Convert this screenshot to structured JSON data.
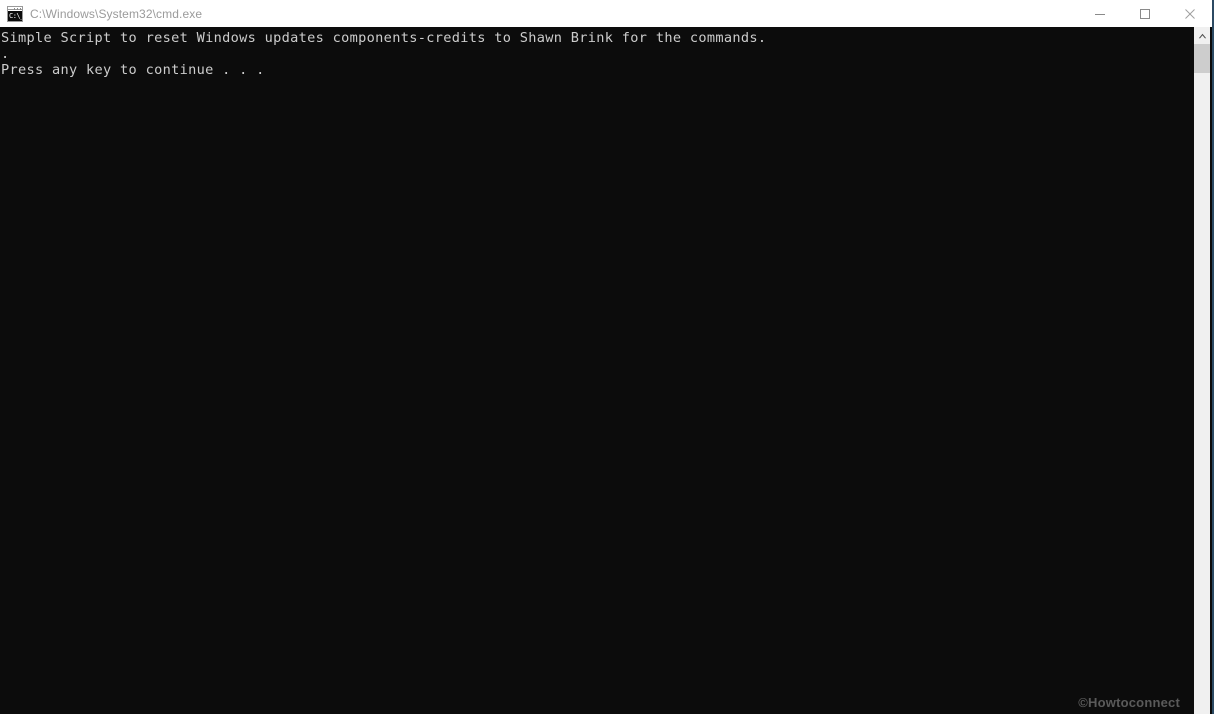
{
  "window": {
    "title": "C:\\Windows\\System32\\cmd.exe",
    "icon_name": "cmd-icon",
    "icon_glyph": "C:\\_",
    "titlebar_bg": "#ffffff",
    "title_color": "#9b9b9b",
    "border_color": "#2c4a63",
    "state": "inactive"
  },
  "controls": {
    "minimize_label": "Minimize",
    "maximize_label": "Maximize",
    "close_label": "Close"
  },
  "console": {
    "background": "#0c0c0c",
    "foreground": "#cccccc",
    "lines": [
      "Simple Script to reset Windows updates components-credits to Shawn Brink for the commands.",
      ".",
      "Press any key to continue . . ."
    ],
    "text": "Simple Script to reset Windows updates components-credits to Shawn Brink for the commands.\n.\nPress any key to continue . . ."
  },
  "scrollbar": {
    "up_arrow_name": "scroll-up-arrow",
    "thumb_position_pct": 0,
    "track_color": "#f0f0f0",
    "thumb_color": "#cdcdcd"
  },
  "watermark": {
    "text": "©Howtoconnect",
    "color": "#5a5a5a"
  }
}
